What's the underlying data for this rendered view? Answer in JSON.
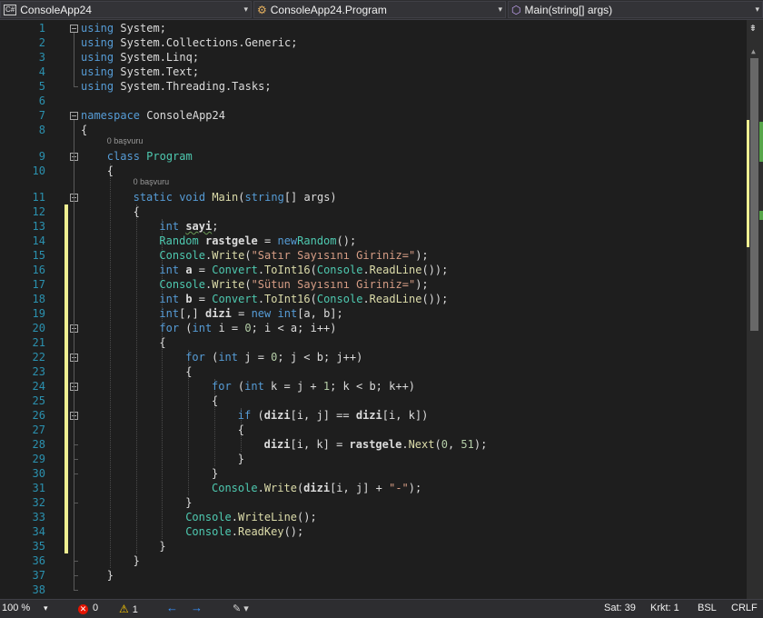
{
  "navbar": {
    "project_badge": "C#",
    "project": "ConsoleApp24",
    "class": "ConsoleApp24.Program",
    "member": "Main(string[] args)",
    "dropdown_icon": "chevron-down-icon",
    "class_icon": "class-icon",
    "method_icon": "method-icon"
  },
  "code": {
    "line_numbers": [
      "1",
      "2",
      "3",
      "4",
      "5",
      "6",
      "7",
      "8",
      "9",
      "10",
      "11",
      "12",
      "13",
      "14",
      "15",
      "16",
      "17",
      "18",
      "19",
      "20",
      "21",
      "22",
      "23",
      "24",
      "25",
      "26",
      "27",
      "28",
      "29",
      "30",
      "31",
      "32",
      "33",
      "34",
      "35",
      "36",
      "37",
      "38"
    ],
    "codelens": [
      "0 başvuru",
      "0 başvuru"
    ],
    "lines": [
      [
        "using",
        "System",
        ";"
      ],
      [
        "using",
        "System.Collections.Generic",
        ";"
      ],
      [
        "using",
        "System.Linq",
        ";"
      ],
      [
        "using",
        "System.Text",
        ";"
      ],
      [
        "using",
        "System.Threading.Tasks",
        ";"
      ],
      [],
      [
        "namespace",
        "ConsoleApp24"
      ],
      [
        "{"
      ],
      [
        "class",
        "Program"
      ],
      [
        "{"
      ],
      [
        "static",
        "void",
        "Main",
        "(",
        "string",
        "[] ",
        "args",
        ")"
      ],
      [
        "{"
      ],
      [
        "int",
        "sayi",
        ";"
      ],
      [
        "Random",
        "rastgele",
        " = ",
        "new",
        "Random",
        "();"
      ],
      [
        "Console",
        ".",
        "Write",
        "(",
        "\"Satır Sayısını Giriniz=\"",
        ");"
      ],
      [
        "int",
        "a",
        " = ",
        "Convert",
        ".",
        "ToInt16",
        "(",
        "Console",
        ".",
        "ReadLine",
        "());"
      ],
      [
        "Console",
        ".",
        "Write",
        "(",
        "\"Sütun Sayısını Giriniz=\"",
        ");"
      ],
      [
        "int",
        "b",
        " = ",
        "Convert",
        ".",
        "ToInt16",
        "(",
        "Console",
        ".",
        "ReadLine",
        "());"
      ],
      [
        "int",
        "[,] ",
        "dizi",
        " = ",
        "new",
        "int",
        "[a, b];"
      ],
      [
        "for",
        " (",
        "int",
        " i = ",
        "0",
        "; i < a; i++)"
      ],
      [
        "{"
      ],
      [
        "for",
        " (",
        "int",
        " j = ",
        "0",
        "; j < b; j++)"
      ],
      [
        "{"
      ],
      [
        "for",
        " (",
        "int",
        " k = j + ",
        "1",
        "; k < b; k++)"
      ],
      [
        "{"
      ],
      [
        "if",
        " (",
        "dizi",
        "[i, j] == ",
        "dizi",
        "[i, k])"
      ],
      [
        "{"
      ],
      [
        "dizi",
        "[i, k] = ",
        "rastgele",
        ".",
        "Next",
        "(",
        "0",
        ", ",
        "51",
        ");"
      ],
      [
        "}"
      ],
      [
        "}"
      ],
      [
        "Console",
        ".",
        "Write",
        "(",
        "dizi",
        "[i, j] + ",
        "\"-\"",
        ");"
      ],
      [
        "}"
      ],
      [
        "Console",
        ".",
        "WriteLine",
        "();"
      ],
      [
        "Console",
        ".",
        "ReadKey",
        "();"
      ],
      [
        "}"
      ],
      [
        "}"
      ],
      [
        "}"
      ],
      [
        ""
      ]
    ]
  },
  "scrollbar": {
    "split_icon": "split-icon",
    "up_icon": "up-arrow-icon"
  },
  "statusbar": {
    "zoom": "100 %",
    "errors": "0",
    "warnings": "1",
    "error_icon": "error-icon",
    "warning_icon": "warning-icon",
    "back_icon": "back-arrow-icon",
    "forward_icon": "forward-arrow-icon",
    "cleanup_icon": "brush-icon",
    "line": "Sat: 39",
    "col": "Krkt: 1",
    "mode": "BSL",
    "eol": "CRLF"
  },
  "colors": {
    "keyword": "#569cd6",
    "type": "#4ec9b0",
    "string": "#d69d85",
    "method": "#dcdcaa",
    "number": "#b5cea8",
    "line_number": "#2b91af",
    "change_bar": "#efef91"
  }
}
